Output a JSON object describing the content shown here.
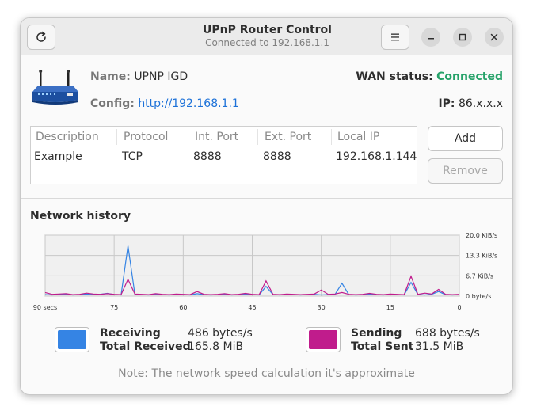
{
  "window": {
    "title": "UPnP Router Control",
    "subtitle": "Connected to 192.168.1.1"
  },
  "info": {
    "name_label": "Name:",
    "name_value": "UPNP IGD",
    "wan_label": "WAN status:",
    "wan_value": "Connected",
    "config_label": "Config:",
    "config_value": "http://192.168.1.1",
    "ip_label": "IP:",
    "ip_value": "86.x.x.x"
  },
  "table": {
    "headers": [
      "Description",
      "Protocol",
      "Int. Port",
      "Ext. Port",
      "Local IP"
    ],
    "rows": [
      [
        "Example",
        "TCP",
        "8888",
        "8888",
        "192.168.1.144"
      ]
    ]
  },
  "buttons": {
    "add": "Add",
    "remove": "Remove"
  },
  "history": {
    "title": "Network history",
    "x_ticks": [
      "90 secs",
      "75",
      "60",
      "45",
      "30",
      "15",
      "0"
    ],
    "y_ticks": [
      "20.0 KiB/s",
      "13.3 KiB/s",
      "6.7 KiB/s",
      "0 byte/s"
    ]
  },
  "chart_data": {
    "type": "line",
    "x": [
      90,
      88.5,
      87,
      85.5,
      84,
      82.5,
      81,
      79.5,
      78,
      76.5,
      75,
      73.5,
      72,
      70.5,
      69,
      67.5,
      66,
      64.5,
      63,
      61.5,
      60,
      58.5,
      57,
      55.5,
      54,
      52.5,
      51,
      49.5,
      48,
      46.5,
      45,
      43.5,
      42,
      40.5,
      39,
      37.5,
      36,
      34.5,
      33,
      31.5,
      30,
      28.5,
      27,
      25.5,
      24,
      22.5,
      21,
      19.5,
      18,
      16.5,
      15,
      13.5,
      12,
      10.5,
      9,
      7.5,
      6,
      4.5,
      3,
      1.5,
      0
    ],
    "xlim": [
      90,
      0
    ],
    "ylim": [
      0,
      20.0
    ],
    "yunit": "KiB/s",
    "series": [
      {
        "name": "Receiving",
        "color": "#3584e4",
        "values": [
          0.5,
          0.4,
          0.5,
          0.6,
          0.4,
          0.5,
          0.7,
          0.5,
          0.6,
          0.9,
          0.5,
          0.4,
          16.5,
          0.6,
          0.5,
          0.4,
          0.6,
          0.5,
          0.4,
          0.6,
          0.5,
          0.4,
          0.8,
          0.5,
          0.4,
          0.5,
          0.6,
          0.4,
          0.5,
          0.7,
          0.5,
          0.4,
          3.2,
          0.5,
          0.4,
          0.6,
          0.5,
          0.4,
          0.5,
          0.6,
          0.4,
          0.5,
          0.6,
          4.2,
          0.5,
          0.4,
          0.5,
          0.7,
          0.5,
          0.4,
          0.6,
          0.5,
          0.4,
          4.5,
          0.5,
          0.4,
          0.6,
          1.5,
          0.5,
          0.4,
          0.5
        ]
      },
      {
        "name": "Sending",
        "color": "#c01c8c",
        "values": [
          1.2,
          0.6,
          0.7,
          0.8,
          0.5,
          0.6,
          1.0,
          0.7,
          0.6,
          0.8,
          0.6,
          0.5,
          5.5,
          0.7,
          0.6,
          0.5,
          0.8,
          0.6,
          0.5,
          0.7,
          0.6,
          0.5,
          1.5,
          0.6,
          0.5,
          0.6,
          0.8,
          0.5,
          0.6,
          0.9,
          0.6,
          0.5,
          5.0,
          0.6,
          0.5,
          0.7,
          0.6,
          0.5,
          0.6,
          0.7,
          2.0,
          0.6,
          0.7,
          1.2,
          0.6,
          0.5,
          0.6,
          0.9,
          0.6,
          0.5,
          0.7,
          0.6,
          0.5,
          6.5,
          0.6,
          1.0,
          0.7,
          2.2,
          0.6,
          0.5,
          0.6
        ]
      }
    ]
  },
  "legend": {
    "receiving_label": "Receiving",
    "receiving_rate": "486 bytes/s",
    "total_received_label": "Total Received",
    "total_received_value": "165.8 MiB",
    "sending_label": "Sending",
    "sending_rate": "688 bytes/s",
    "total_sent_label": "Total Sent",
    "total_sent_value": "31.5 MiB",
    "receiving_color": "#3584e4",
    "sending_color": "#c01c8c"
  },
  "note": "Note: The network speed calculation it's approximate",
  "icons": {
    "refresh": "refresh-icon",
    "menu": "hamburger-menu-icon",
    "router": "router-icon",
    "minimize": "minimize-icon",
    "maximize": "maximize-icon",
    "close": "close-icon"
  }
}
